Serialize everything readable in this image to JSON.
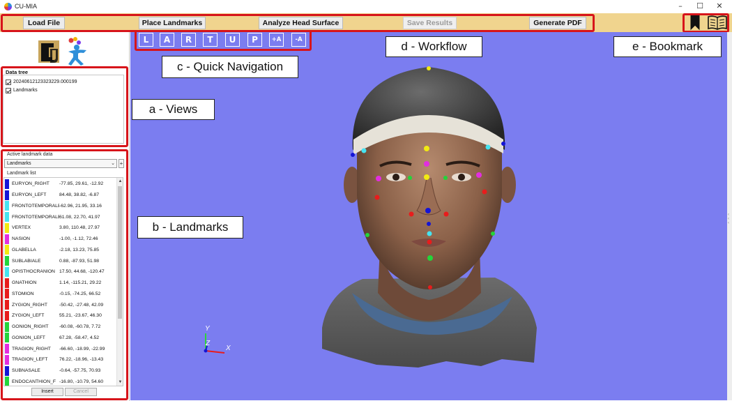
{
  "window": {
    "title": "CU-MIA",
    "minimize": "–",
    "maximize": "☐",
    "close": "✕"
  },
  "toolbar": {
    "load_file": "Load File",
    "place_landmarks": "Place Landmarks",
    "analyze_head_surface": "Analyze Head Surface",
    "save_results": "Save Results",
    "generate_pdf": "Generate PDF"
  },
  "quick_nav": [
    "L",
    "A",
    "R",
    "T",
    "U",
    "P",
    "+A",
    "-A"
  ],
  "data_tree": {
    "title": "Data tree",
    "items": [
      {
        "label": "20240612123323229.000199",
        "checked": true
      },
      {
        "label": "Landmarks",
        "checked": true
      }
    ]
  },
  "landmark_panel": {
    "title": "Active landmark data",
    "selected": "Landmarks",
    "add_symbol": "+",
    "list_label": "Landmark list",
    "insert": "Insert",
    "cancel": "Cancel",
    "landmarks": [
      {
        "name": "EURYON_RIGHT",
        "coords": "-77.85, 29.61, -12.92",
        "color": "#1414d6"
      },
      {
        "name": "EURYON_LEFT",
        "coords": "84.48, 38.82, -6.87",
        "color": "#1414d6"
      },
      {
        "name": "FRONTOTEMPORALE",
        "coords": "-62.96, 21.95, 33.16",
        "color": "#45e3f0"
      },
      {
        "name": "FRONTOTEMPORALE",
        "coords": "61.08, 22.70, 41.97",
        "color": "#45e3f0"
      },
      {
        "name": "VERTEX",
        "coords": "3.80, 110.48, 27.97",
        "color": "#f2ea12"
      },
      {
        "name": "NASION",
        "coords": "-1.00, -1.12, 72.46",
        "color": "#e22ee0"
      },
      {
        "name": "GLABELLA",
        "coords": "-2.18, 13.23, 75.85",
        "color": "#f2ea12"
      },
      {
        "name": "SUBLABIALE",
        "coords": "0.88, -87.93, 51.98",
        "color": "#24d43a"
      },
      {
        "name": "OPISTHOCRANION",
        "coords": "17.50, 44.68, -120.47",
        "color": "#45e3f0"
      },
      {
        "name": "GNATHION",
        "coords": "1.14, -115.21, 29.22",
        "color": "#e81c1c"
      },
      {
        "name": "STOMION",
        "coords": "-0.15, -74.25, 66.52",
        "color": "#e81c1c"
      },
      {
        "name": "ZYGION_RIGHT",
        "coords": "-50.42, -27.48, 42.09",
        "color": "#e81c1c"
      },
      {
        "name": "ZYGION_LEFT",
        "coords": "55.21, -23.67, 46.30",
        "color": "#e81c1c"
      },
      {
        "name": "GONION_RIGHT",
        "coords": "-60.08, -60.78, 7.72",
        "color": "#24d43a"
      },
      {
        "name": "GONION_LEFT",
        "coords": "67.28, -58.47, 4.52",
        "color": "#24d43a"
      },
      {
        "name": "TRAGION_RIGHT",
        "coords": "-66.60, -18.99, -22.99",
        "color": "#e22ee0"
      },
      {
        "name": "TRAGION_LEFT",
        "coords": "76.22, -18.96, -13.43",
        "color": "#e22ee0"
      },
      {
        "name": "SUBNASALE",
        "coords": "-0.64, -57.75, 70.93",
        "color": "#1414d6"
      },
      {
        "name": "ENDOCANTHION_F",
        "coords": "-16.80, -10.79, 54.60",
        "color": "#24d43a"
      }
    ]
  },
  "axes": {
    "x": "X",
    "y": "Y",
    "z": "Z"
  },
  "callouts": {
    "views": "a - Views",
    "landmarks": "b - Landmarks",
    "quick_navigation": "c - Quick Navigation",
    "workflow": "d - Workflow",
    "bookmark": "e - Bookmark"
  },
  "colors": {
    "toolbar": "#f0d48e",
    "viewport": "#7b7df0",
    "highlight": "#d7141a"
  }
}
